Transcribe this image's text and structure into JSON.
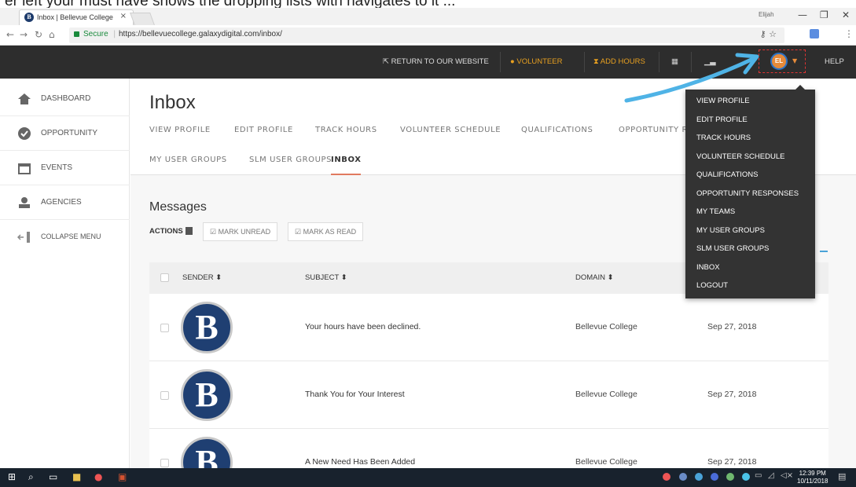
{
  "caption": "er left your must have shows the dropping lists with navigates to it ...",
  "browser": {
    "tab_title": "Inbox | Bellevue College",
    "tab_close": "×",
    "window_label": "Elijah",
    "secure_label": "Secure",
    "url": "https://bellevuecollege.galaxydigital.com/inbox/"
  },
  "header": {
    "return_label": "RETURN TO OUR WEBSITE",
    "volunteer_label": "VOLUNTEER",
    "add_hours_label": "ADD HOURS",
    "avatar_initials": "EL",
    "help_label": "HELP",
    "accent": "#e8a020"
  },
  "sidebar": {
    "items": [
      {
        "label": "DASHBOARD"
      },
      {
        "label": "OPPORTUNITY"
      },
      {
        "label": "EVENTS"
      },
      {
        "label": "AGENCIES"
      },
      {
        "label": "COLLAPSE MENU"
      }
    ]
  },
  "main": {
    "title": "Inbox",
    "tabs_row1": [
      "VIEW PROFILE",
      "EDIT PROFILE",
      "TRACK HOURS",
      "VOLUNTEER SCHEDULE",
      "QUALIFICATIONS",
      "OPPORTUNITY R"
    ],
    "tabs_row2": [
      "MY USER GROUPS",
      "SLM USER GROUPS",
      "INBOX"
    ],
    "messages_title": "Messages",
    "actions_label": "ACTIONS",
    "mark_unread_label": "MARK UNREAD",
    "mark_read_label": "MARK AS READ"
  },
  "table": {
    "columns": [
      "SENDER",
      "SUBJECT",
      "DOMAIN"
    ],
    "rows": [
      {
        "logo_letter": "B",
        "subject": "Your hours have been declined.",
        "domain": "Bellevue College",
        "date": "Sep 27, 2018"
      },
      {
        "logo_letter": "B",
        "subject": "Thank You for Your Interest",
        "domain": "Bellevue College",
        "date": "Sep 27, 2018"
      },
      {
        "logo_letter": "B",
        "subject": "A New Need Has Been Added",
        "domain": "Bellevue College",
        "date": "Sep 27, 2018"
      }
    ]
  },
  "dropdown": {
    "items": [
      "VIEW PROFILE",
      "EDIT PROFILE",
      "TRACK HOURS",
      "VOLUNTEER SCHEDULE",
      "QUALIFICATIONS",
      "OPPORTUNITY RESPONSES",
      "MY TEAMS",
      "MY USER GROUPS",
      "SLM USER GROUPS",
      "INBOX",
      "LOGOUT"
    ]
  },
  "taskbar": {
    "time": "12:39 PM",
    "date": "10/11/2018"
  }
}
